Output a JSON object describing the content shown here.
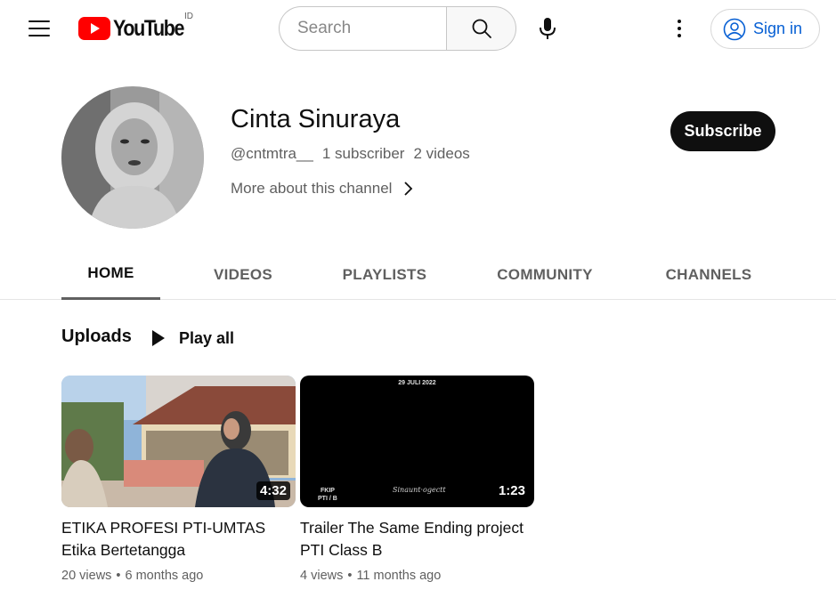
{
  "header": {
    "logo_text": "YouTube",
    "country_code": "ID",
    "search_placeholder": "Search",
    "signin_label": "Sign in"
  },
  "channel": {
    "name": "Cinta Sinuraya",
    "handle": "@cntmtra__",
    "subscribers": "1 subscriber",
    "videos_count": "2 videos",
    "more_about": "More about this channel",
    "subscribe_label": "Subscribe"
  },
  "tabs": [
    {
      "label": "HOME",
      "active": true
    },
    {
      "label": "VIDEOS",
      "active": false
    },
    {
      "label": "PLAYLISTS",
      "active": false
    },
    {
      "label": "COMMUNITY",
      "active": false
    },
    {
      "label": "CHANNELS",
      "active": false
    }
  ],
  "uploads": {
    "title": "Uploads",
    "play_all_label": "Play all"
  },
  "videos": [
    {
      "title": "ETIKA PROFESI PTI-UMTAS Etika Bertetangga",
      "duration": "4:32",
      "views": "20 views",
      "age": "6 months ago"
    },
    {
      "title": "Trailer The Same Ending project PTI Class B",
      "duration": "1:23",
      "views": "4 views",
      "age": "11 months ago",
      "thumb_date": "29 JULI 2022",
      "thumb_left_text_1": "FKIP",
      "thumb_left_text_2": "PTI / B",
      "thumb_signature": "Sinaunt·ogectt"
    }
  ],
  "colors": {
    "brand_red": "#ff0000",
    "link_blue": "#065fd4",
    "text_primary": "#0f0f0f",
    "text_secondary": "#606060"
  }
}
